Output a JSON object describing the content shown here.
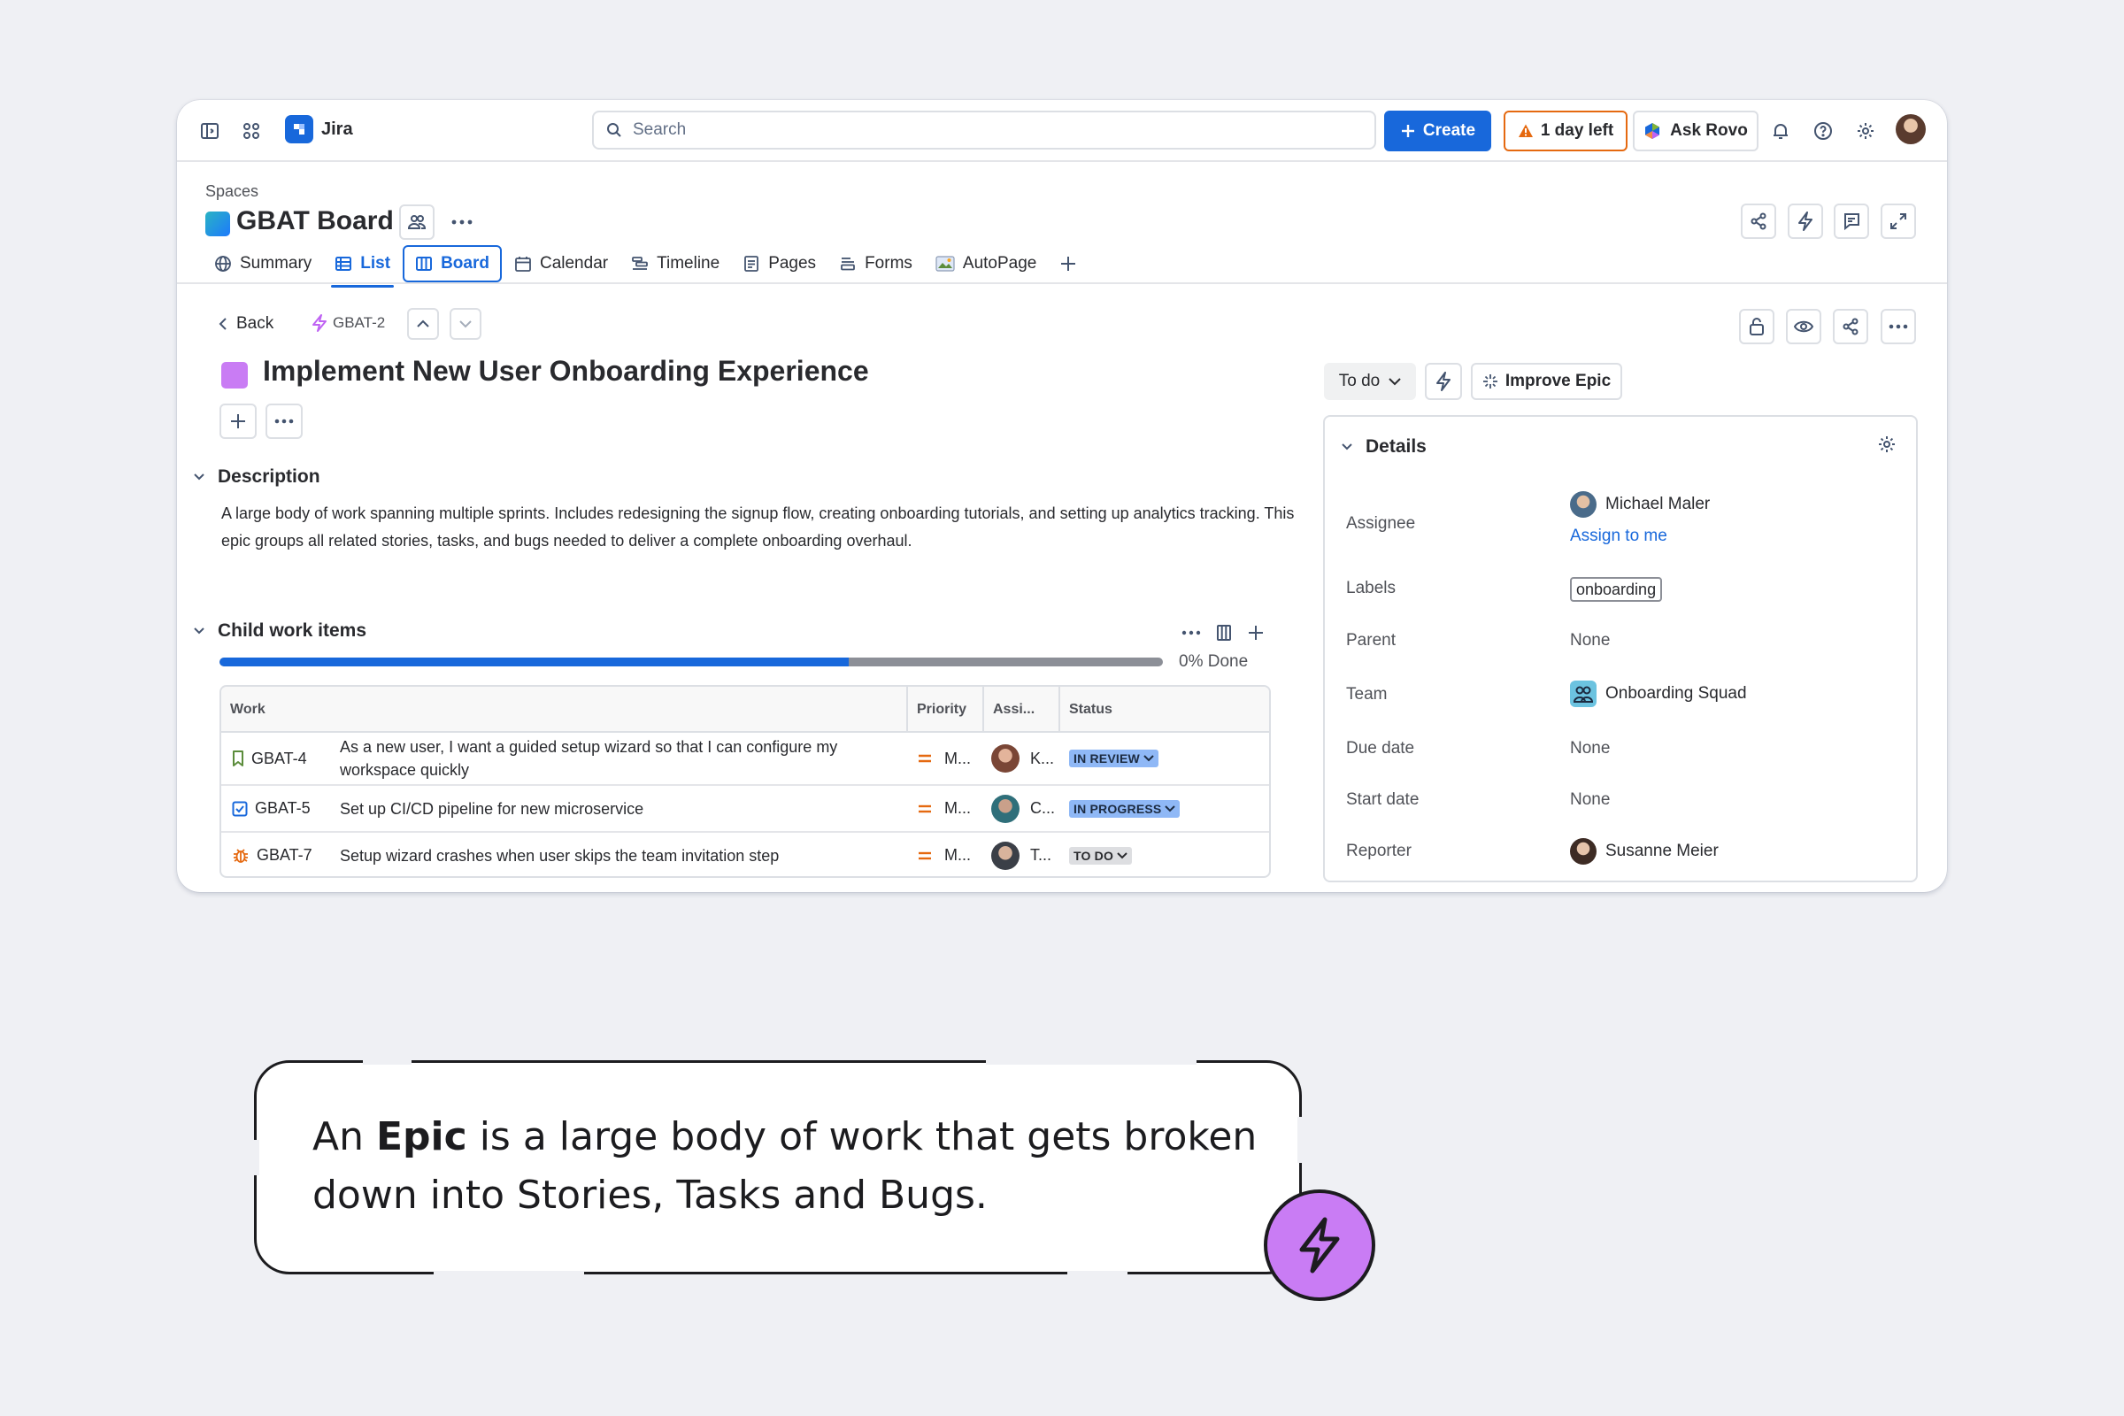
{
  "topbar": {
    "app_name": "Jira",
    "search_placeholder": "Search",
    "create_label": "Create",
    "trial_label": "1 day left",
    "rovo_label": "Ask Rovo"
  },
  "space": {
    "breadcrumb": "Spaces",
    "title": "GBAT Board",
    "tabs": [
      {
        "label": "Summary",
        "icon": "globe-icon"
      },
      {
        "label": "List",
        "icon": "list-icon"
      },
      {
        "label": "Board",
        "icon": "board-icon"
      },
      {
        "label": "Calendar",
        "icon": "calendar-icon"
      },
      {
        "label": "Timeline",
        "icon": "timeline-icon"
      },
      {
        "label": "Pages",
        "icon": "pages-icon"
      },
      {
        "label": "Forms",
        "icon": "forms-icon"
      },
      {
        "label": "AutoPage",
        "icon": "autopage-icon"
      }
    ]
  },
  "issue": {
    "back_label": "Back",
    "key": "GBAT-2",
    "title": "Implement New User Onboarding Experience",
    "description_heading": "Description",
    "description": "A large body of work spanning multiple sprints. Includes redesigning the signup flow, creating onboarding tutorials, and setting up analytics tracking. This epic groups all related stories, tasks, and bugs needed to deliver a complete onboarding overhaul.",
    "child_heading": "Child work items",
    "progress_done_fraction": 0.0,
    "progress_label": "0% Done",
    "table": {
      "headers": [
        "Work",
        "Priority",
        "Assi...",
        "Status"
      ],
      "rows": [
        {
          "key": "GBAT-4",
          "type": "story-icon",
          "summary": "As a new user, I want a guided setup wizard so that I can configure my workspace quickly",
          "priority": "M...",
          "assignee": "K...",
          "status": "IN REVIEW"
        },
        {
          "key": "GBAT-5",
          "type": "task-icon",
          "summary": "Set up CI/CD pipeline for new microservice",
          "priority": "M...",
          "assignee": "C...",
          "status": "IN PROGRESS"
        },
        {
          "key": "GBAT-7",
          "type": "bug-icon",
          "summary": "Setup wizard crashes when user skips the team invitation step",
          "priority": "M...",
          "assignee": "T...",
          "status": "TO DO"
        }
      ]
    }
  },
  "side": {
    "status_label": "To do",
    "improve_label": "Improve Epic",
    "details_heading": "Details",
    "fields": {
      "assignee_label": "Assignee",
      "assignee_value": "Michael Maler",
      "assign_to_me": "Assign to me",
      "labels_label": "Labels",
      "labels_value": "onboarding",
      "parent_label": "Parent",
      "parent_value": "None",
      "team_label": "Team",
      "team_value": "Onboarding Squad",
      "due_label": "Due date",
      "due_value": "None",
      "start_label": "Start date",
      "start_value": "None",
      "reporter_label": "Reporter",
      "reporter_value": "Susanne Meier"
    }
  },
  "callout": {
    "prefix": "An ",
    "bold": "Epic",
    "rest": " is a large body of work that gets broken down into Stories, Tasks and Bugs."
  },
  "colors": {
    "brand_blue": "#1868db",
    "epic_purple": "#c97cf4",
    "trial_orange": "#e56910"
  }
}
